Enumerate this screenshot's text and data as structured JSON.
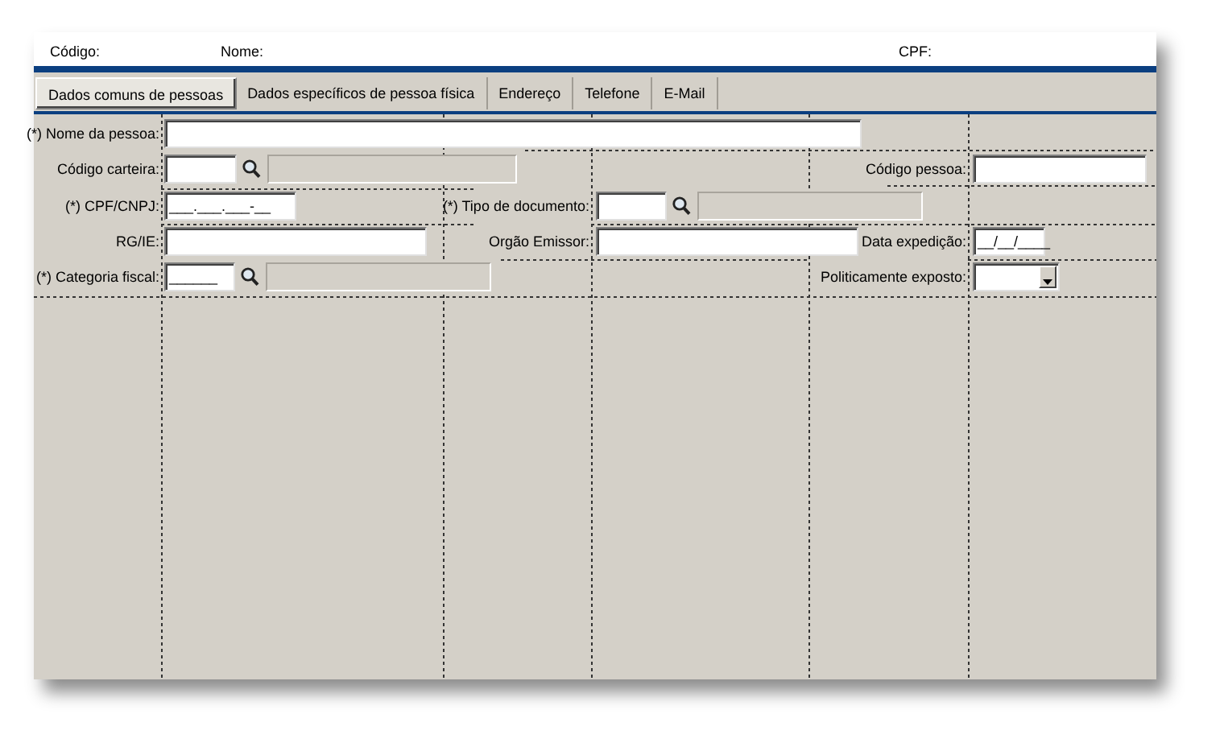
{
  "header": {
    "fields": [
      {
        "label": "Código:"
      },
      {
        "label": "Nome:"
      },
      {
        "label": "CPF:"
      }
    ]
  },
  "tabs": [
    {
      "label": "Dados comuns de pessoas",
      "selected": true
    },
    {
      "label": "Dados específicos de pessoa física",
      "selected": false
    },
    {
      "label": "Endereço",
      "selected": false
    },
    {
      "label": "Telefone",
      "selected": false
    },
    {
      "label": "E-Mail",
      "selected": false
    }
  ],
  "form": {
    "rows": [
      [
        {
          "label": "(*) Nome da pessoa:",
          "kind": "text"
        }
      ],
      [
        {
          "label": "Código carteira:",
          "kind": "lookup"
        },
        {
          "label": "Código pessoa:",
          "kind": "text"
        }
      ],
      [
        {
          "label": "(*) CPF/CNPJ:",
          "kind": "text",
          "value": "___.___.___-__"
        },
        {
          "label": "(*) Tipo de documento:",
          "kind": "lookup"
        }
      ],
      [
        {
          "label": "RG/IE:",
          "kind": "text"
        },
        {
          "label": "Orgão Emissor:",
          "kind": "text"
        },
        {
          "label": "Data expedição:",
          "kind": "text",
          "value": "__/__/____"
        }
      ],
      [
        {
          "label": "(*) Categoria fiscal:",
          "kind": "lookup",
          "value": "______"
        },
        {
          "label": "Politicamente exposto:",
          "kind": "select"
        }
      ]
    ]
  }
}
